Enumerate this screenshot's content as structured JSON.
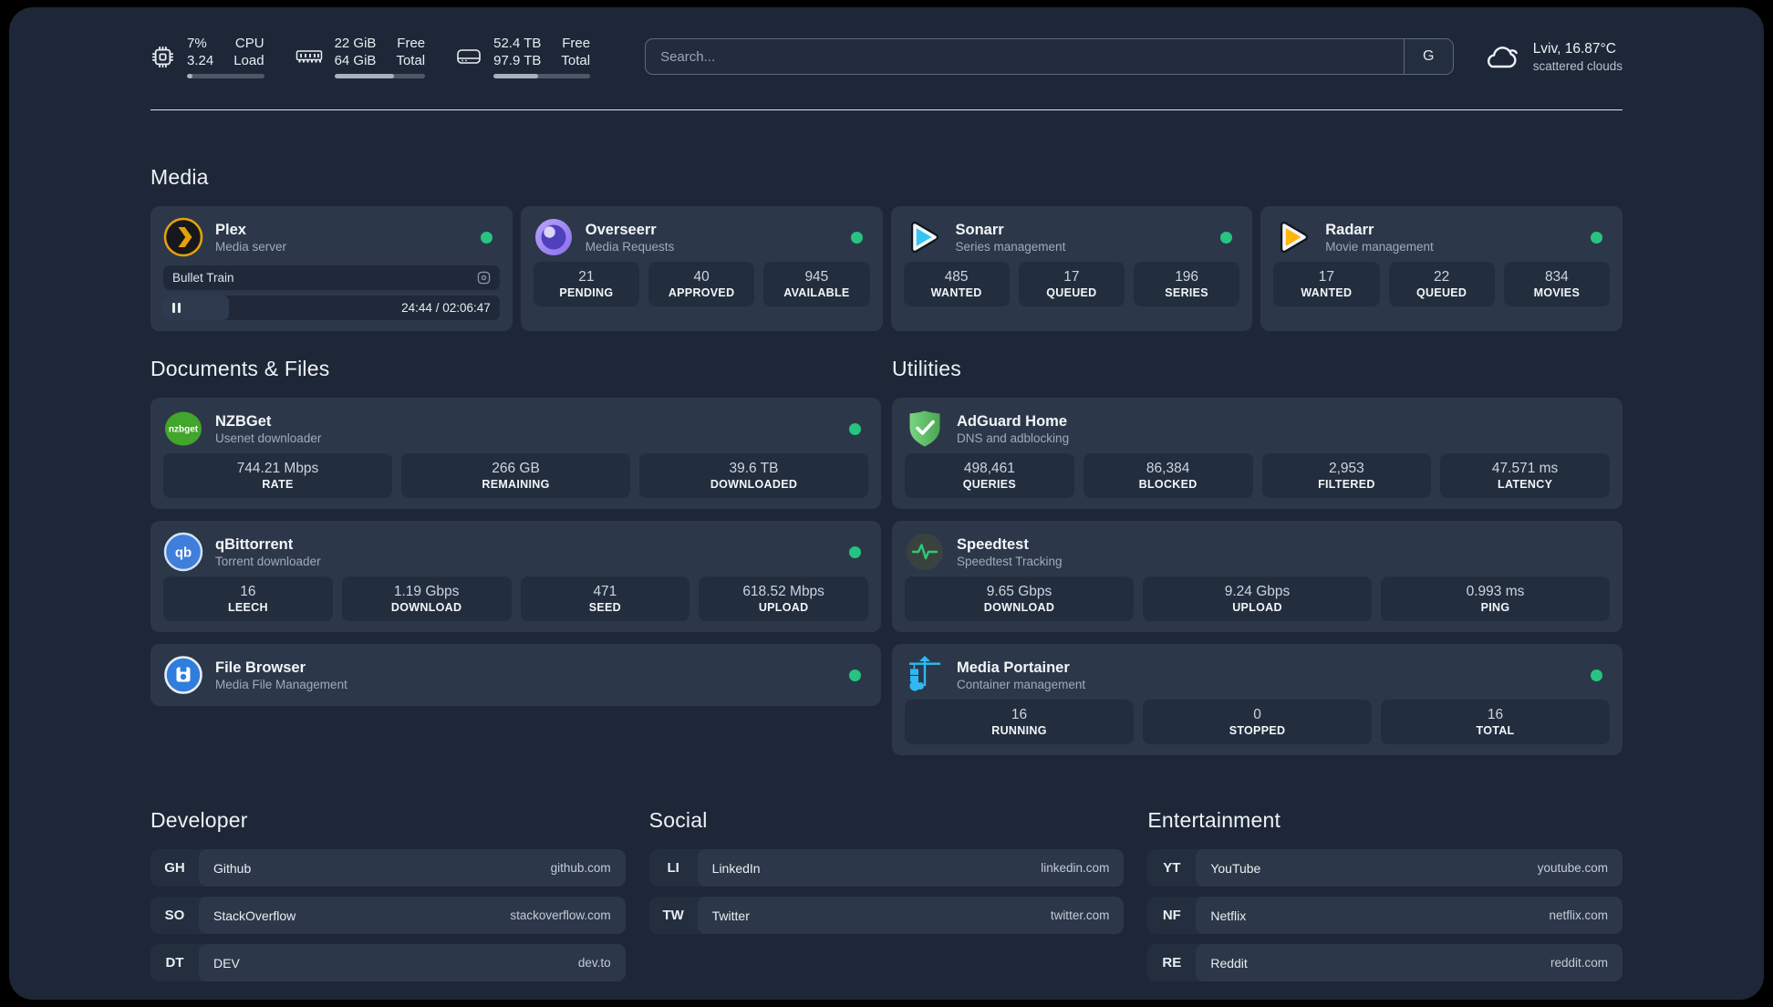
{
  "colors": {
    "status_online": "#27c481",
    "progress_track": "#4d5969",
    "progress_fill": "#a9b2bd"
  },
  "topbar": {
    "stats": [
      {
        "id": "cpu",
        "icon": "cpu-icon",
        "values": [
          "7%",
          "3.24"
        ],
        "labels": [
          "CPU",
          "Load"
        ],
        "progress_pct": 7
      },
      {
        "id": "memory",
        "icon": "memory-icon",
        "values": [
          "22 GiB",
          "64 GiB"
        ],
        "labels": [
          "Free",
          "Total"
        ],
        "progress_pct": 66
      },
      {
        "id": "disk",
        "icon": "disk-icon",
        "values": [
          "52.4 TB",
          "97.9 TB"
        ],
        "labels": [
          "Free",
          "Total"
        ],
        "progress_pct": 46
      }
    ],
    "search": {
      "placeholder": "Search...",
      "button_label": "G"
    },
    "weather": {
      "icon": "cloud-icon",
      "line1": "Lviv, 16.87°C",
      "line2": "scattered clouds"
    }
  },
  "sections": {
    "media": {
      "title": "Media",
      "cards": [
        {
          "name": "Plex",
          "subtitle": "Media server",
          "icon": "plex-icon",
          "brand": "#e5a00d",
          "online": true,
          "player": {
            "title": "Bullet Train",
            "time": "24:44 / 02:06:47",
            "progress_pct": 19.5
          }
        },
        {
          "name": "Overseerr",
          "subtitle": "Media Requests",
          "icon": "overseerr-icon",
          "brand": "#8a6ef0",
          "online": true,
          "stats": [
            {
              "value": "21",
              "label": "PENDING"
            },
            {
              "value": "40",
              "label": "APPROVED"
            },
            {
              "value": "945",
              "label": "AVAILABLE"
            }
          ]
        },
        {
          "name": "Sonarr",
          "subtitle": "Series management",
          "icon": "sonarr-icon",
          "brand": "#35c5f4",
          "online": true,
          "stats": [
            {
              "value": "485",
              "label": "WANTED"
            },
            {
              "value": "17",
              "label": "QUEUED"
            },
            {
              "value": "196",
              "label": "SERIES"
            }
          ]
        },
        {
          "name": "Radarr",
          "subtitle": "Movie management",
          "icon": "radarr-icon",
          "brand": "#ffb60a",
          "online": true,
          "stats": [
            {
              "value": "17",
              "label": "WANTED"
            },
            {
              "value": "22",
              "label": "QUEUED"
            },
            {
              "value": "834",
              "label": "MOVIES"
            }
          ]
        }
      ]
    },
    "documents": {
      "title": "Documents & Files",
      "cards": [
        {
          "name": "NZBGet",
          "subtitle": "Usenet downloader",
          "icon": "nzbget-icon",
          "brand": "#42a52c",
          "online": true,
          "stats": [
            {
              "value": "744.21 Mbps",
              "label": "RATE"
            },
            {
              "value": "266 GB",
              "label": "REMAINING"
            },
            {
              "value": "39.6 TB",
              "label": "DOWNLOADED"
            }
          ]
        },
        {
          "name": "qBittorrent",
          "subtitle": "Torrent downloader",
          "icon": "qbittorrent-icon",
          "brand": "#3f7fdb",
          "online": true,
          "stats": [
            {
              "value": "16",
              "label": "LEECH"
            },
            {
              "value": "1.19 Gbps",
              "label": "DOWNLOAD"
            },
            {
              "value": "471",
              "label": "SEED"
            },
            {
              "value": "618.52 Mbps",
              "label": "UPLOAD"
            }
          ]
        },
        {
          "name": "File Browser",
          "subtitle": "Media File Management",
          "icon": "filebrowser-icon",
          "brand": "#2f7ddd",
          "online": true
        }
      ]
    },
    "utilities": {
      "title": "Utilities",
      "cards": [
        {
          "name": "AdGuard Home",
          "subtitle": "DNS and adblocking",
          "icon": "adguard-icon",
          "brand": "#5fc568",
          "online": false,
          "stats": [
            {
              "value": "498,461",
              "label": "QUERIES"
            },
            {
              "value": "86,384",
              "label": "BLOCKED"
            },
            {
              "value": "2,953",
              "label": "FILTERED"
            },
            {
              "value": "47.571 ms",
              "label": "LATENCY"
            }
          ]
        },
        {
          "name": "Speedtest",
          "subtitle": "Speedtest Tracking",
          "icon": "speedtest-icon",
          "brand": "#2ecc71",
          "online": false,
          "stats": [
            {
              "value": "9.65 Gbps",
              "label": "DOWNLOAD"
            },
            {
              "value": "9.24 Gbps",
              "label": "UPLOAD"
            },
            {
              "value": "0.993 ms",
              "label": "PING"
            }
          ]
        },
        {
          "name": "Media Portainer",
          "subtitle": "Container management",
          "icon": "portainer-icon",
          "brand": "#2fb9f2",
          "online": true,
          "stats": [
            {
              "value": "16",
              "label": "RUNNING"
            },
            {
              "value": "0",
              "label": "STOPPED"
            },
            {
              "value": "16",
              "label": "TOTAL"
            }
          ]
        }
      ]
    },
    "bookmarks": [
      {
        "title": "Developer",
        "links": [
          {
            "abbr": "GH",
            "name": "Github",
            "url": "github.com"
          },
          {
            "abbr": "SO",
            "name": "StackOverflow",
            "url": "stackoverflow.com"
          },
          {
            "abbr": "DT",
            "name": "DEV",
            "url": "dev.to"
          }
        ]
      },
      {
        "title": "Social",
        "links": [
          {
            "abbr": "LI",
            "name": "LinkedIn",
            "url": "linkedin.com"
          },
          {
            "abbr": "TW",
            "name": "Twitter",
            "url": "twitter.com"
          }
        ]
      },
      {
        "title": "Entertainment",
        "links": [
          {
            "abbr": "YT",
            "name": "YouTube",
            "url": "youtube.com"
          },
          {
            "abbr": "NF",
            "name": "Netflix",
            "url": "netflix.com"
          },
          {
            "abbr": "RE",
            "name": "Reddit",
            "url": "reddit.com"
          }
        ]
      }
    ]
  }
}
